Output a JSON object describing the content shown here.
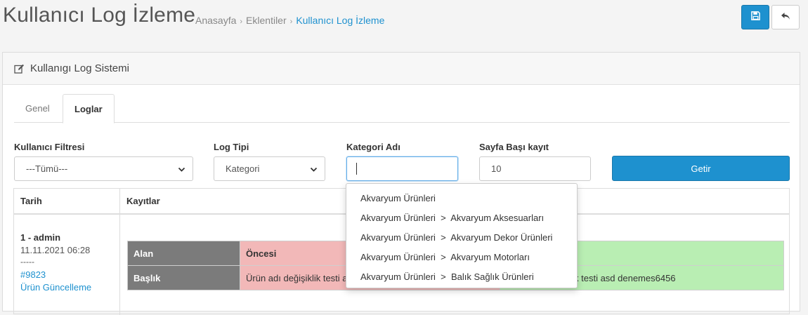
{
  "header": {
    "title": "Kullanıcı Log İzleme",
    "breadcrumb": [
      "Anasayfa",
      "Eklentiler",
      "Kullanıcı Log İzleme"
    ],
    "save_icon": "floppy-disk-icon",
    "back_icon": "reply-icon"
  },
  "panel": {
    "title": "Kullanıgı Log Sistemi",
    "title_icon": "edit-icon"
  },
  "tabs": [
    {
      "label": "Genel",
      "active": false
    },
    {
      "label": "Loglar",
      "active": true
    }
  ],
  "filters": {
    "user_label": "Kullanıcı Filtresi",
    "user_value": "---Tümü---",
    "logtype_label": "Log Tipi",
    "logtype_value": "Kategori",
    "category_label": "Kategori Adı",
    "category_value": "",
    "perpage_label": "Sayfa Başı kayıt",
    "perpage_value": "10",
    "submit_label": "Getir"
  },
  "table": {
    "headers": [
      "Tarih",
      "Kayıtlar"
    ],
    "rows": [
      {
        "user": "1 - admin",
        "date": "11.11.2021 06:28",
        "dash": "-----",
        "link1": "#9823",
        "link2": "Ürün Güncelleme",
        "compare": [
          {
            "key": "Alan",
            "old": "Öncesi",
            "new": ""
          },
          {
            "key": "Başlık",
            "old": "Ürün adı değişiklik testi a",
            "new": "k testi asd denemes6456"
          }
        ]
      }
    ]
  },
  "autocomplete": [
    "Akvaryum Ürünleri",
    "Akvaryum Ürünleri  >  Akvaryum Aksesuarları",
    "Akvaryum Ürünleri  >  Akvaryum Dekor Ürünleri",
    "Akvaryum Ürünleri  >  Akvaryum Motorları",
    "Akvaryum Ürünleri  >  Balık Sağlık Ürünleri"
  ],
  "colors": {
    "primary": "#1e91cf",
    "old_value_bg": "#f2b8b8",
    "new_value_bg": "#b9eeb3",
    "key_bg": "#7b7b7b"
  }
}
